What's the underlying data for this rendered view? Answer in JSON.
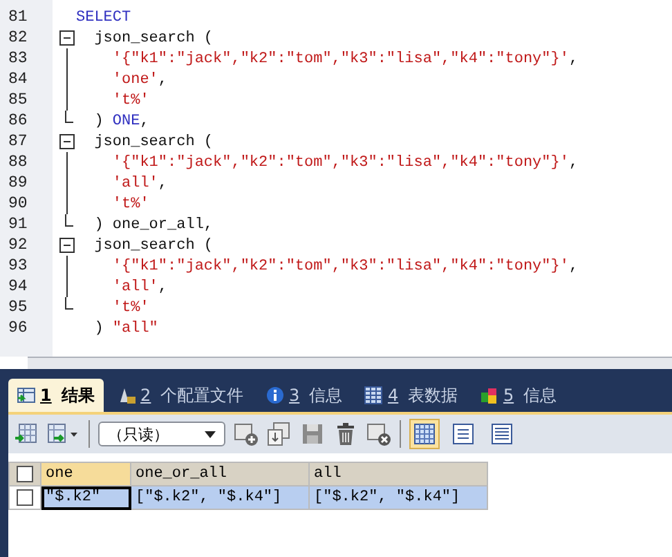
{
  "editor": {
    "lines": [
      {
        "number": "81",
        "kind": "plain",
        "tokens": [
          {
            "kind": "keyword",
            "text": "SELECT"
          }
        ]
      },
      {
        "number": "82",
        "kind": "fold_start",
        "tokens": [
          {
            "kind": "plain",
            "text": "  json_search ("
          }
        ]
      },
      {
        "number": "83",
        "kind": "fold_line",
        "tokens": [
          {
            "kind": "string",
            "text": "    '{\"k1\":\"jack\",\"k2\":\"tom\",\"k3\":\"lisa\",\"k4\":\"tony\"}'"
          },
          {
            "kind": "plain",
            "text": ","
          }
        ]
      },
      {
        "number": "84",
        "kind": "fold_line",
        "tokens": [
          {
            "kind": "string",
            "text": "    'one'"
          },
          {
            "kind": "plain",
            "text": ","
          }
        ]
      },
      {
        "number": "85",
        "kind": "fold_line",
        "tokens": [
          {
            "kind": "string",
            "text": "    't%'"
          }
        ]
      },
      {
        "number": "86",
        "kind": "fold_end",
        "tokens": [
          {
            "kind": "plain",
            "text": "  )"
          },
          {
            "kind": "keyword",
            "text": " ONE"
          },
          {
            "kind": "plain",
            "text": ","
          }
        ]
      },
      {
        "number": "87",
        "kind": "fold_start",
        "tokens": [
          {
            "kind": "plain",
            "text": "  json_search ("
          }
        ]
      },
      {
        "number": "88",
        "kind": "fold_line",
        "tokens": [
          {
            "kind": "string",
            "text": "    '{\"k1\":\"jack\",\"k2\":\"tom\",\"k3\":\"lisa\",\"k4\":\"tony\"}'"
          },
          {
            "kind": "plain",
            "text": ","
          }
        ]
      },
      {
        "number": "89",
        "kind": "fold_line",
        "tokens": [
          {
            "kind": "string",
            "text": "    'all'"
          },
          {
            "kind": "plain",
            "text": ","
          }
        ]
      },
      {
        "number": "90",
        "kind": "fold_line",
        "tokens": [
          {
            "kind": "string",
            "text": "    't%'"
          }
        ]
      },
      {
        "number": "91",
        "kind": "fold_end",
        "tokens": [
          {
            "kind": "plain",
            "text": "  ) one_or_all,"
          }
        ]
      },
      {
        "number": "92",
        "kind": "fold_start",
        "tokens": [
          {
            "kind": "plain",
            "text": "  json_search ("
          }
        ]
      },
      {
        "number": "93",
        "kind": "fold_line",
        "tokens": [
          {
            "kind": "string",
            "text": "    '{\"k1\":\"jack\",\"k2\":\"tom\",\"k3\":\"lisa\",\"k4\":\"tony\"}'"
          },
          {
            "kind": "plain",
            "text": ","
          }
        ]
      },
      {
        "number": "94",
        "kind": "fold_line",
        "tokens": [
          {
            "kind": "string",
            "text": "    'all'"
          },
          {
            "kind": "plain",
            "text": ","
          }
        ]
      },
      {
        "number": "95",
        "kind": "fold_end",
        "tokens": [
          {
            "kind": "string",
            "text": "    't%'"
          }
        ]
      },
      {
        "number": "96",
        "kind": "plain",
        "tokens": [
          {
            "kind": "plain",
            "text": "  ) "
          },
          {
            "kind": "string",
            "text": "\"all\""
          }
        ]
      }
    ]
  },
  "tabs": [
    {
      "number": "1",
      "label": "结果",
      "kind": "result",
      "selected": true
    },
    {
      "number": "2",
      "label": "个配置文件",
      "kind": "profile",
      "selected": false
    },
    {
      "number": "3",
      "label": "信息",
      "kind": "info",
      "selected": false
    },
    {
      "number": "4",
      "label": "表数据",
      "kind": "table",
      "selected": false
    },
    {
      "number": "5",
      "label": "信息",
      "kind": "info_colors",
      "selected": false
    }
  ],
  "toolbar": {
    "mode_select": {
      "value": "（只读）"
    },
    "views": [
      {
        "kind": "grid",
        "selected": true
      },
      {
        "kind": "form",
        "selected": false
      },
      {
        "kind": "text",
        "selected": false
      }
    ]
  },
  "table": {
    "all_checked": false,
    "columns": [
      "one",
      "one_or_all",
      "all"
    ],
    "rows": [
      {
        "checked": false,
        "selected": true,
        "cells": [
          "\"$.k2\"",
          "[\"$.k2\", \"$.k4\"]",
          "[\"$.k2\", \"$.k4\"]"
        ]
      }
    ]
  }
}
